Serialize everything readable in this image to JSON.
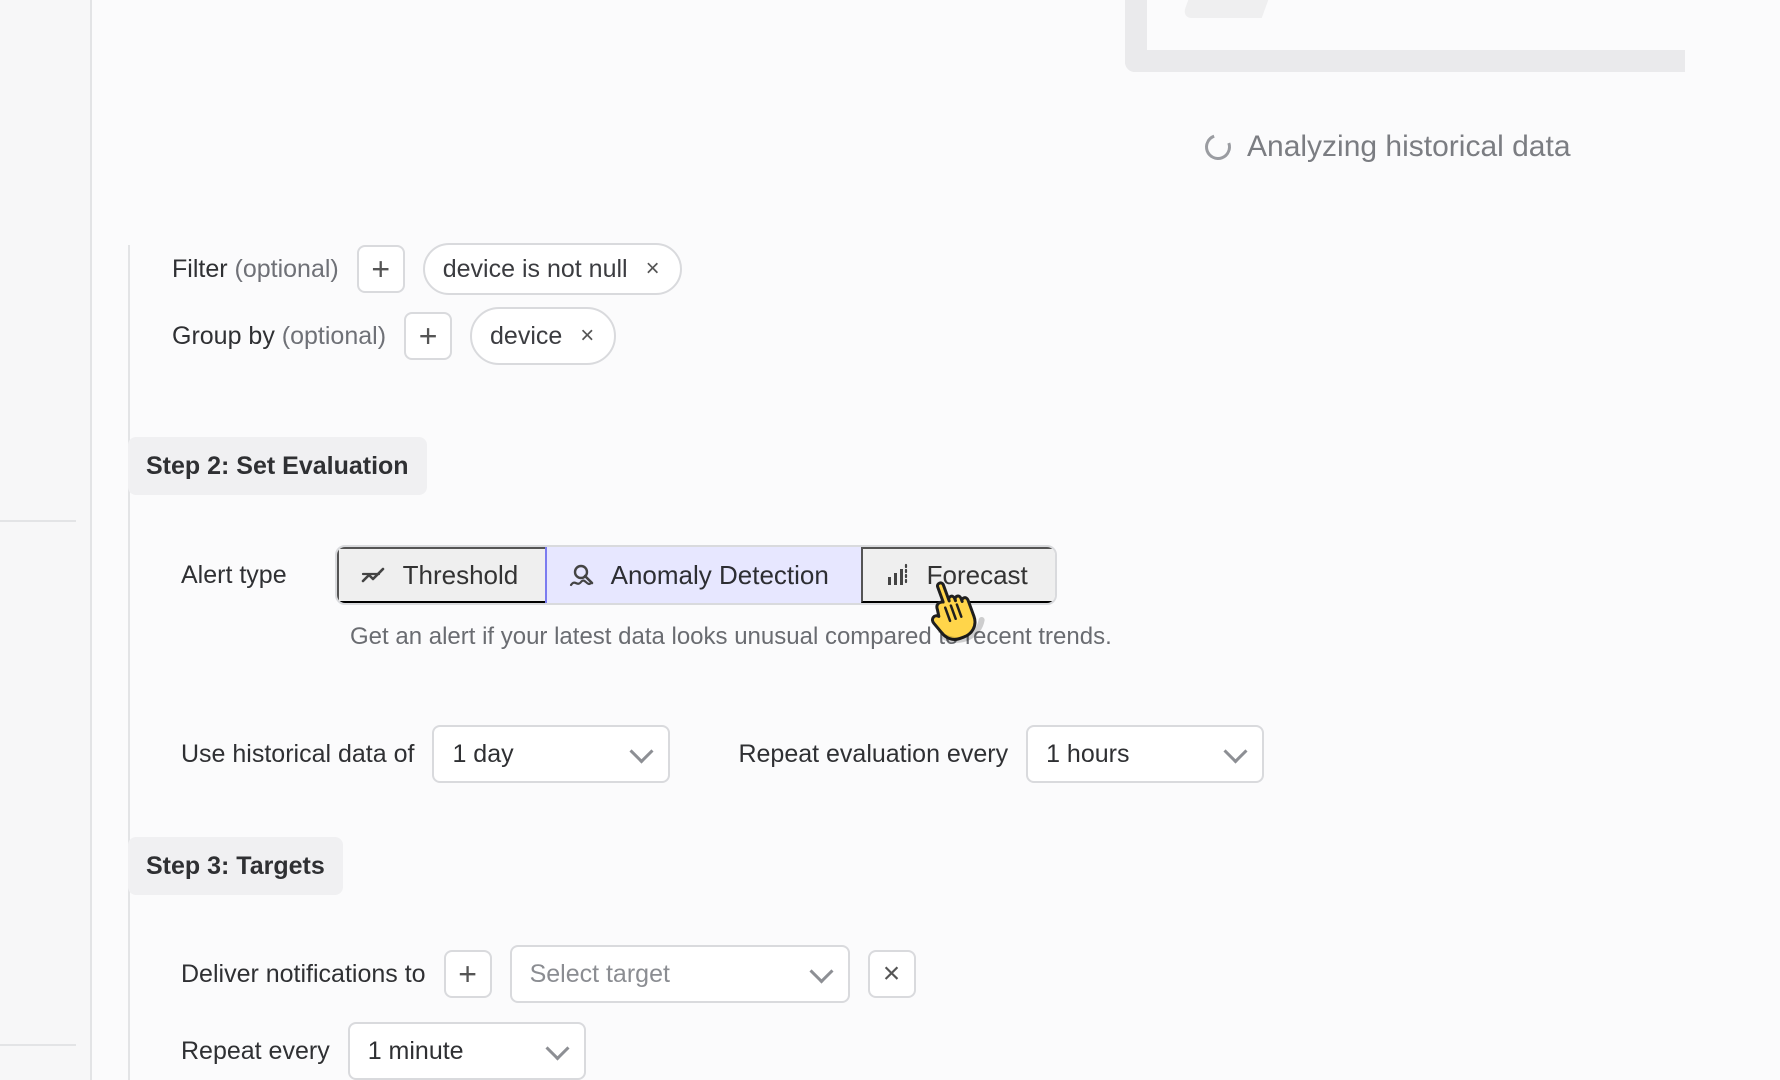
{
  "status": {
    "analyzing_text": "Analyzing historical data"
  },
  "filter": {
    "label": "Filter",
    "optional": "(optional)",
    "add_symbol": "+",
    "chip_text": "device is not null",
    "chip_remove": "×"
  },
  "group_by": {
    "label": "Group by",
    "optional": "(optional)",
    "add_symbol": "+",
    "chip_text": "device",
    "chip_remove": "×"
  },
  "step2": {
    "title": "Step 2: Set Evaluation",
    "alert_type_label": "Alert type",
    "types": [
      {
        "label": "Threshold",
        "icon": "threshold-icon"
      },
      {
        "label": "Anomaly Detection",
        "icon": "anomaly-icon",
        "active": true
      },
      {
        "label": "Forecast",
        "icon": "forecast-icon"
      }
    ],
    "description": "Get an alert if your latest data looks unusual compared to recent trends.",
    "historical_label": "Use historical data of",
    "historical_value": "1 day",
    "repeat_eval_label": "Repeat evaluation every",
    "repeat_eval_value": "1 hours"
  },
  "step3": {
    "title": "Step 3: Targets",
    "deliver_label": "Deliver notifications to",
    "add_symbol": "+",
    "target_placeholder": "Select target",
    "clear_symbol": "×",
    "repeat_label": "Repeat every",
    "repeat_value": "1 minute"
  },
  "colors": {
    "accent": "#7b7cf0",
    "accent_bg": "#e7e7ff",
    "border": "#d9dadd"
  }
}
